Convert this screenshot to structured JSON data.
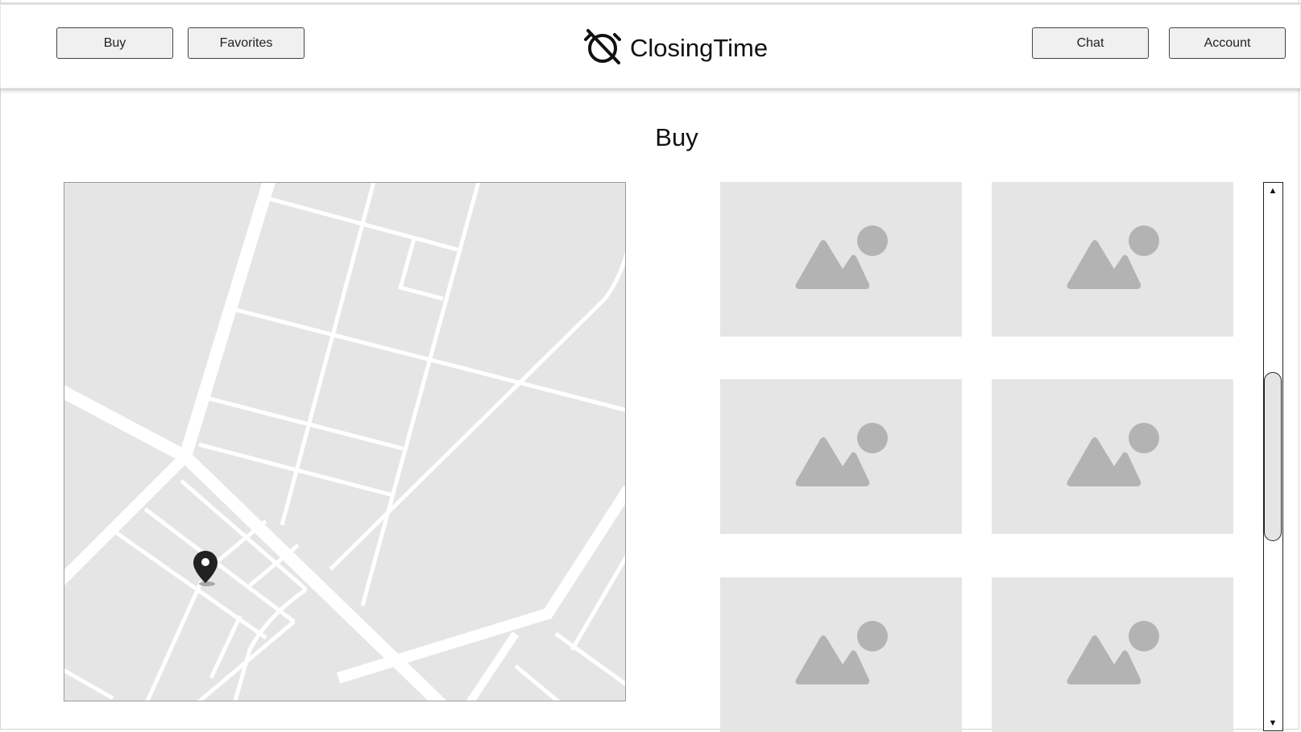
{
  "header": {
    "nav_left": [
      {
        "label": "Buy"
      },
      {
        "label": "Favorites"
      }
    ],
    "brand": {
      "name": "ClosingTime",
      "icon": "alarm-off-icon"
    },
    "nav_right": [
      {
        "label": "Chat"
      },
      {
        "label": "Account"
      }
    ]
  },
  "main": {
    "title": "Buy",
    "map": {
      "marker_icon": "map-pin-icon"
    },
    "listings": [
      {
        "image_icon": "image-placeholder-icon"
      },
      {
        "image_icon": "image-placeholder-icon"
      },
      {
        "image_icon": "image-placeholder-icon"
      },
      {
        "image_icon": "image-placeholder-icon"
      },
      {
        "image_icon": "image-placeholder-icon"
      },
      {
        "image_icon": "image-placeholder-icon"
      }
    ]
  },
  "colors": {
    "map_bg": "#e5e5e5",
    "road": "#ffffff",
    "placeholder_bg": "#e5e5e5",
    "placeholder_icon": "#b3b3b3",
    "button_bg": "#f0f0f0"
  }
}
